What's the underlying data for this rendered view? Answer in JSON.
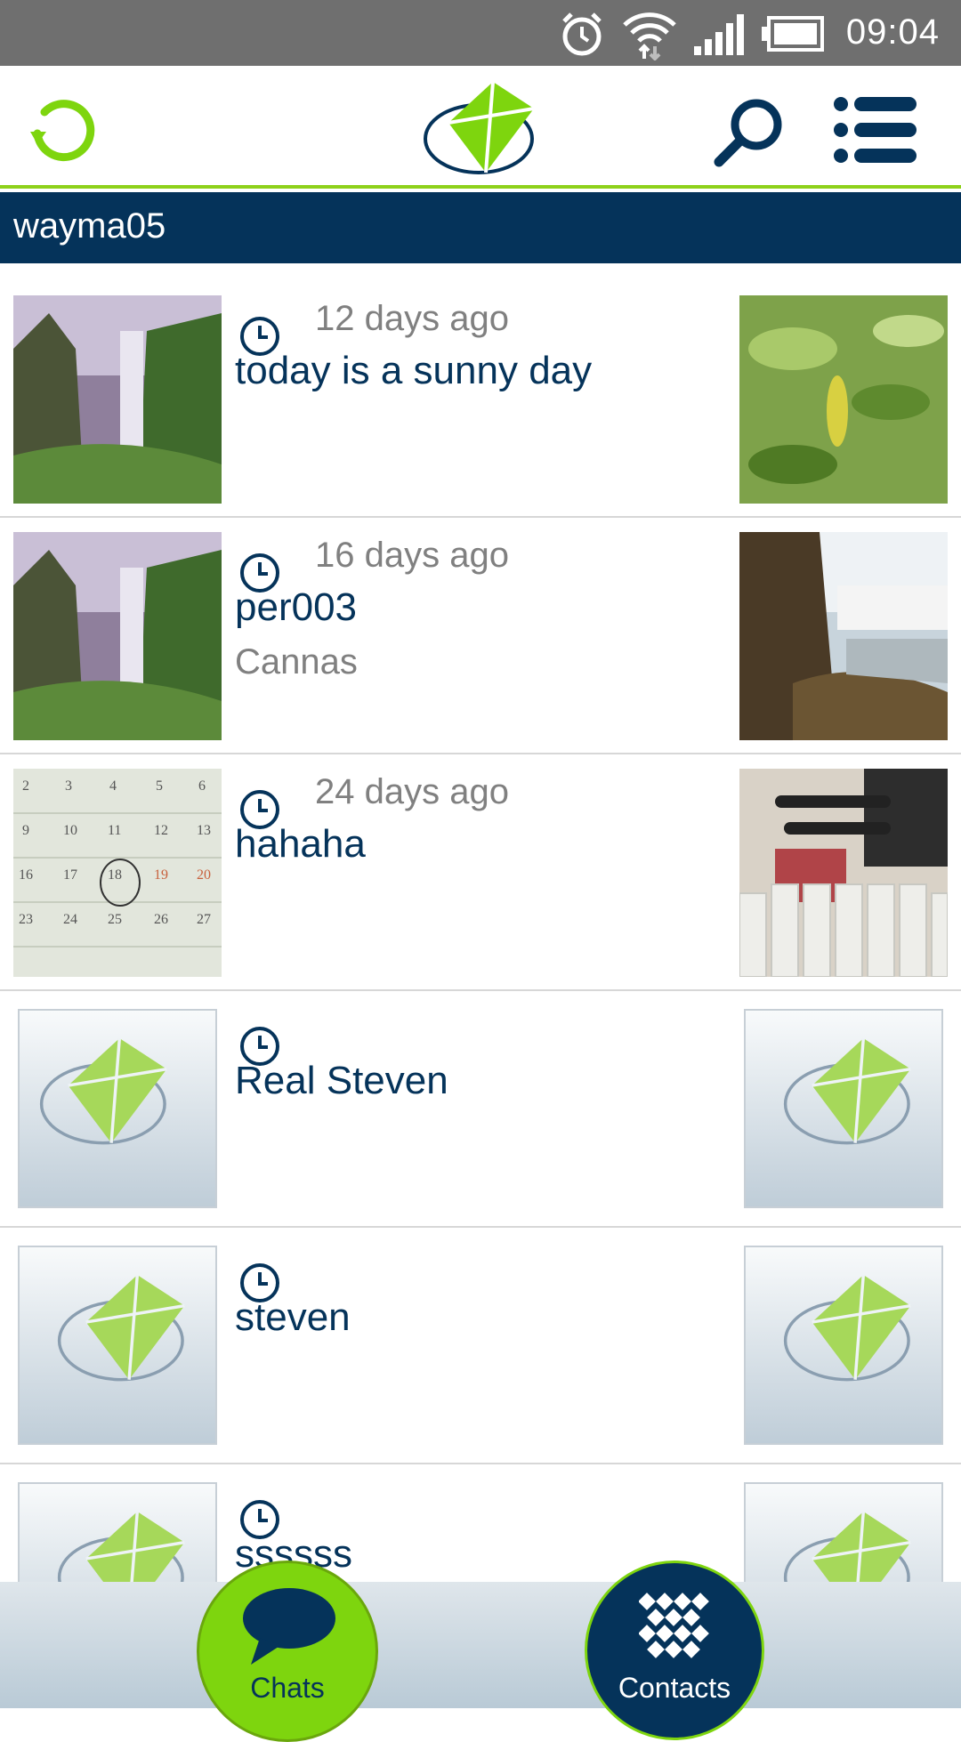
{
  "status_bar": {
    "time": "09:04",
    "icons": [
      "alarm-icon",
      "wifi-icon",
      "signal-icon",
      "battery-icon"
    ]
  },
  "app_bar": {
    "icons": [
      "refresh-icon",
      "app-logo",
      "search-icon",
      "menu-icon"
    ]
  },
  "user": {
    "name": "wayma05"
  },
  "colors": {
    "navy": "#05335a",
    "green": "#7ed50e",
    "gray_text": "#808080"
  },
  "conversations": [
    {
      "time_ago": "12 days ago",
      "title": "today is a sunny day",
      "subtitle": ""
    },
    {
      "time_ago": "16 days ago",
      "title": "per003",
      "subtitle": "Cannas"
    },
    {
      "time_ago": "24 days ago",
      "title": "hahaha",
      "subtitle": ""
    },
    {
      "time_ago": "",
      "title": "Real Steven",
      "subtitle": ""
    },
    {
      "time_ago": "",
      "title": "steven",
      "subtitle": ""
    },
    {
      "time_ago": "",
      "title": "ssssss",
      "subtitle": ""
    }
  ],
  "bottom_nav": {
    "chats_label": "Chats",
    "contacts_label": "Contacts"
  }
}
